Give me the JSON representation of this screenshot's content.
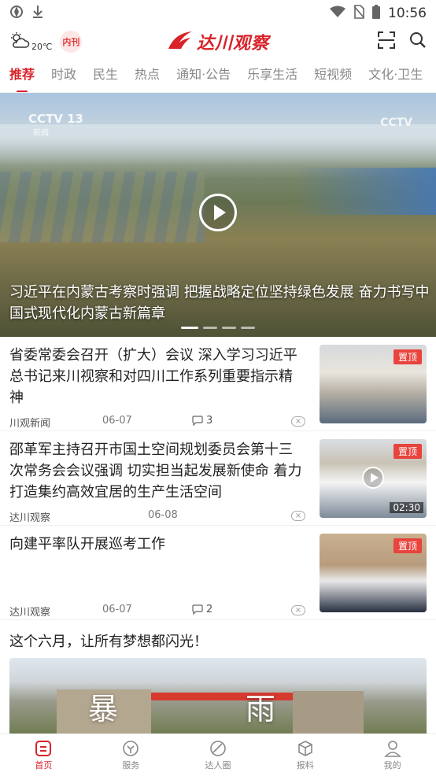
{
  "status_bar": {
    "time": "10:56"
  },
  "header": {
    "temperature": "20℃",
    "badge": "内刊",
    "app_name": "达川观察"
  },
  "tabs": [
    "推荐",
    "时政",
    "民生",
    "热点",
    "通知·公告",
    "乐享生活",
    "短视频",
    "文化·卫生"
  ],
  "hero": {
    "cctv_left": "CCTV 13",
    "cctv_left_sub": "新闻",
    "cctv_right": "CCTV",
    "title": "习近平在内蒙古考察时强调 把握战略定位坚持绿色发展 奋力书写中国式现代化内蒙古新篇章"
  },
  "news": [
    {
      "headline": "省委常委会召开（扩大）会议 深入学习习近平总书记来川视察和对四川工作系列重要指示精神",
      "source": "川观新闻",
      "date": "06-07",
      "comments": "3",
      "pin": "置顶"
    },
    {
      "headline": "邵革军主持召开市国土空间规划委员会第十三次常务会会议强调 切实担当起发展新使命 着力打造集约高效宜居的生产生活空间",
      "source": "达川观察",
      "date": "06-08",
      "pin": "置顶",
      "duration": "02:30"
    },
    {
      "headline": "向建平率队开展巡考工作",
      "source": "达川观察",
      "date": "06-07",
      "comments": "2",
      "pin": "置顶"
    }
  ],
  "feature": {
    "title": "这个六月，让所有梦想都闪光！",
    "char1": "暴",
    "char2": "雨"
  },
  "bottom_nav": [
    "首页",
    "服务",
    "达人圈",
    "报料",
    "我的"
  ],
  "colors": {
    "accent": "#d8232a",
    "pin": "#e8443e"
  }
}
